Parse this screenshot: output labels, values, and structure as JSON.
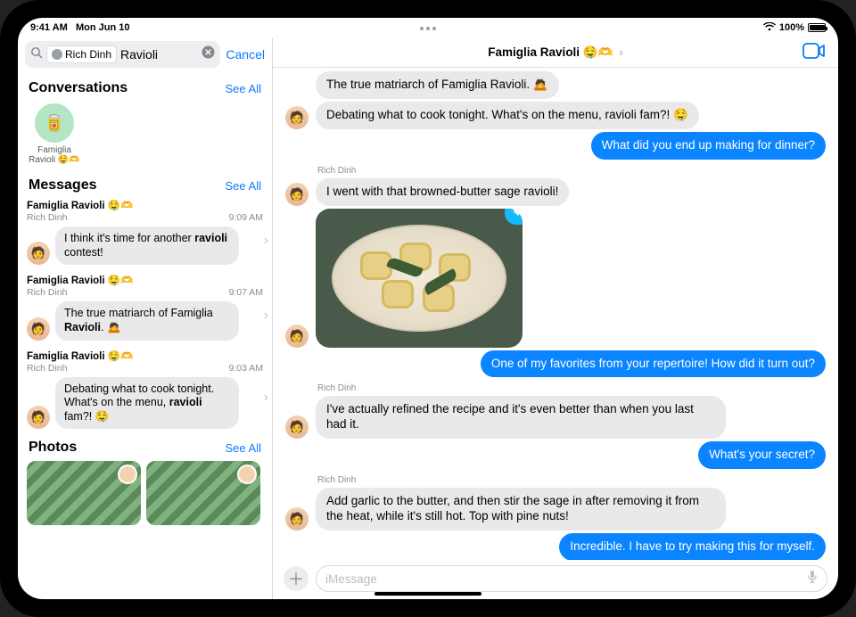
{
  "status": {
    "time": "9:41 AM",
    "date": "Mon Jun 10",
    "battery_pct": "100%"
  },
  "search": {
    "chip_name": "Rich Dinh",
    "query": "Ravioli",
    "cancel": "Cancel"
  },
  "sections": {
    "conversations": {
      "title": "Conversations",
      "see_all": "See All"
    },
    "messages": {
      "title": "Messages",
      "see_all": "See All"
    },
    "photos": {
      "title": "Photos",
      "see_all": "See All"
    }
  },
  "conversation_result": {
    "avatar_emoji": "🥫",
    "label": "Famiglia Ravioli 🤤🫶"
  },
  "message_results": [
    {
      "group": "Famiglia Ravioli 🤤🫶",
      "sender": "Rich Dinh",
      "time": "9:09 AM",
      "html": "I think it's time for another <b>ravioli</b> contest!"
    },
    {
      "group": "Famiglia Ravioli 🤤🫶",
      "sender": "Rich Dinh",
      "time": "9:07 AM",
      "html": "The true matriarch of Famiglia <b>Ravioli</b>. 🙇"
    },
    {
      "group": "Famiglia Ravioli 🤤🫶",
      "sender": "Rich Dinh",
      "time": "9:03 AM",
      "html": "Debating what to cook tonight. What's on the menu, <b>ravioli</b> fam?! 🤤"
    }
  ],
  "main": {
    "title": "Famiglia Ravioli 🤤🫶",
    "compose_placeholder": "iMessage"
  },
  "thread": [
    {
      "type": "recv",
      "sender": "",
      "avatar": false,
      "text": "The true matriarch of Famiglia Ravioli. 🙇"
    },
    {
      "type": "recv",
      "sender": "",
      "avatar": true,
      "text": "Debating what to cook tonight. What's on the menu, ravioli fam?! 🤤"
    },
    {
      "type": "sent",
      "text": "What did you end up making for dinner?"
    },
    {
      "type": "name",
      "text": "Rich Dinh"
    },
    {
      "type": "recv",
      "sender": "",
      "avatar": true,
      "text": "I went with that browned-butter sage ravioli!"
    },
    {
      "type": "image",
      "reaction": "❤"
    },
    {
      "type": "sent",
      "text": "One of my favorites from your repertoire! How did it turn out?"
    },
    {
      "type": "name",
      "text": "Rich Dinh"
    },
    {
      "type": "recv",
      "sender": "",
      "avatar": true,
      "text": "I've actually refined the recipe and it's even better than when you last had it."
    },
    {
      "type": "sent",
      "text": "What's your secret?"
    },
    {
      "type": "name",
      "text": "Rich Dinh"
    },
    {
      "type": "recv",
      "sender": "",
      "avatar": true,
      "text": "Add garlic to the butter, and then stir the sage in after removing it from the heat, while it's still hot. Top with pine nuts!"
    },
    {
      "type": "sent",
      "text": "Incredible. I have to try making this for myself."
    }
  ]
}
